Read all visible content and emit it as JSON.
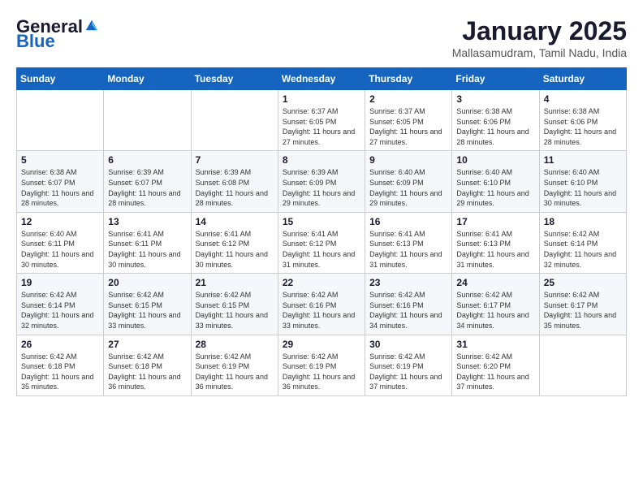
{
  "header": {
    "logo_general": "General",
    "logo_blue": "Blue",
    "month_title": "January 2025",
    "location": "Mallasamudram, Tamil Nadu, India"
  },
  "weekdays": [
    "Sunday",
    "Monday",
    "Tuesday",
    "Wednesday",
    "Thursday",
    "Friday",
    "Saturday"
  ],
  "weeks": [
    [
      {
        "day": "",
        "sunrise": "",
        "sunset": "",
        "daylight": ""
      },
      {
        "day": "",
        "sunrise": "",
        "sunset": "",
        "daylight": ""
      },
      {
        "day": "",
        "sunrise": "",
        "sunset": "",
        "daylight": ""
      },
      {
        "day": "1",
        "sunrise": "Sunrise: 6:37 AM",
        "sunset": "Sunset: 6:05 PM",
        "daylight": "Daylight: 11 hours and 27 minutes."
      },
      {
        "day": "2",
        "sunrise": "Sunrise: 6:37 AM",
        "sunset": "Sunset: 6:05 PM",
        "daylight": "Daylight: 11 hours and 27 minutes."
      },
      {
        "day": "3",
        "sunrise": "Sunrise: 6:38 AM",
        "sunset": "Sunset: 6:06 PM",
        "daylight": "Daylight: 11 hours and 28 minutes."
      },
      {
        "day": "4",
        "sunrise": "Sunrise: 6:38 AM",
        "sunset": "Sunset: 6:06 PM",
        "daylight": "Daylight: 11 hours and 28 minutes."
      }
    ],
    [
      {
        "day": "5",
        "sunrise": "Sunrise: 6:38 AM",
        "sunset": "Sunset: 6:07 PM",
        "daylight": "Daylight: 11 hours and 28 minutes."
      },
      {
        "day": "6",
        "sunrise": "Sunrise: 6:39 AM",
        "sunset": "Sunset: 6:07 PM",
        "daylight": "Daylight: 11 hours and 28 minutes."
      },
      {
        "day": "7",
        "sunrise": "Sunrise: 6:39 AM",
        "sunset": "Sunset: 6:08 PM",
        "daylight": "Daylight: 11 hours and 28 minutes."
      },
      {
        "day": "8",
        "sunrise": "Sunrise: 6:39 AM",
        "sunset": "Sunset: 6:09 PM",
        "daylight": "Daylight: 11 hours and 29 minutes."
      },
      {
        "day": "9",
        "sunrise": "Sunrise: 6:40 AM",
        "sunset": "Sunset: 6:09 PM",
        "daylight": "Daylight: 11 hours and 29 minutes."
      },
      {
        "day": "10",
        "sunrise": "Sunrise: 6:40 AM",
        "sunset": "Sunset: 6:10 PM",
        "daylight": "Daylight: 11 hours and 29 minutes."
      },
      {
        "day": "11",
        "sunrise": "Sunrise: 6:40 AM",
        "sunset": "Sunset: 6:10 PM",
        "daylight": "Daylight: 11 hours and 30 minutes."
      }
    ],
    [
      {
        "day": "12",
        "sunrise": "Sunrise: 6:40 AM",
        "sunset": "Sunset: 6:11 PM",
        "daylight": "Daylight: 11 hours and 30 minutes."
      },
      {
        "day": "13",
        "sunrise": "Sunrise: 6:41 AM",
        "sunset": "Sunset: 6:11 PM",
        "daylight": "Daylight: 11 hours and 30 minutes."
      },
      {
        "day": "14",
        "sunrise": "Sunrise: 6:41 AM",
        "sunset": "Sunset: 6:12 PM",
        "daylight": "Daylight: 11 hours and 30 minutes."
      },
      {
        "day": "15",
        "sunrise": "Sunrise: 6:41 AM",
        "sunset": "Sunset: 6:12 PM",
        "daylight": "Daylight: 11 hours and 31 minutes."
      },
      {
        "day": "16",
        "sunrise": "Sunrise: 6:41 AM",
        "sunset": "Sunset: 6:13 PM",
        "daylight": "Daylight: 11 hours and 31 minutes."
      },
      {
        "day": "17",
        "sunrise": "Sunrise: 6:41 AM",
        "sunset": "Sunset: 6:13 PM",
        "daylight": "Daylight: 11 hours and 31 minutes."
      },
      {
        "day": "18",
        "sunrise": "Sunrise: 6:42 AM",
        "sunset": "Sunset: 6:14 PM",
        "daylight": "Daylight: 11 hours and 32 minutes."
      }
    ],
    [
      {
        "day": "19",
        "sunrise": "Sunrise: 6:42 AM",
        "sunset": "Sunset: 6:14 PM",
        "daylight": "Daylight: 11 hours and 32 minutes."
      },
      {
        "day": "20",
        "sunrise": "Sunrise: 6:42 AM",
        "sunset": "Sunset: 6:15 PM",
        "daylight": "Daylight: 11 hours and 33 minutes."
      },
      {
        "day": "21",
        "sunrise": "Sunrise: 6:42 AM",
        "sunset": "Sunset: 6:15 PM",
        "daylight": "Daylight: 11 hours and 33 minutes."
      },
      {
        "day": "22",
        "sunrise": "Sunrise: 6:42 AM",
        "sunset": "Sunset: 6:16 PM",
        "daylight": "Daylight: 11 hours and 33 minutes."
      },
      {
        "day": "23",
        "sunrise": "Sunrise: 6:42 AM",
        "sunset": "Sunset: 6:16 PM",
        "daylight": "Daylight: 11 hours and 34 minutes."
      },
      {
        "day": "24",
        "sunrise": "Sunrise: 6:42 AM",
        "sunset": "Sunset: 6:17 PM",
        "daylight": "Daylight: 11 hours and 34 minutes."
      },
      {
        "day": "25",
        "sunrise": "Sunrise: 6:42 AM",
        "sunset": "Sunset: 6:17 PM",
        "daylight": "Daylight: 11 hours and 35 minutes."
      }
    ],
    [
      {
        "day": "26",
        "sunrise": "Sunrise: 6:42 AM",
        "sunset": "Sunset: 6:18 PM",
        "daylight": "Daylight: 11 hours and 35 minutes."
      },
      {
        "day": "27",
        "sunrise": "Sunrise: 6:42 AM",
        "sunset": "Sunset: 6:18 PM",
        "daylight": "Daylight: 11 hours and 36 minutes."
      },
      {
        "day": "28",
        "sunrise": "Sunrise: 6:42 AM",
        "sunset": "Sunset: 6:19 PM",
        "daylight": "Daylight: 11 hours and 36 minutes."
      },
      {
        "day": "29",
        "sunrise": "Sunrise: 6:42 AM",
        "sunset": "Sunset: 6:19 PM",
        "daylight": "Daylight: 11 hours and 36 minutes."
      },
      {
        "day": "30",
        "sunrise": "Sunrise: 6:42 AM",
        "sunset": "Sunset: 6:19 PM",
        "daylight": "Daylight: 11 hours and 37 minutes."
      },
      {
        "day": "31",
        "sunrise": "Sunrise: 6:42 AM",
        "sunset": "Sunset: 6:20 PM",
        "daylight": "Daylight: 11 hours and 37 minutes."
      },
      {
        "day": "",
        "sunrise": "",
        "sunset": "",
        "daylight": ""
      }
    ]
  ]
}
